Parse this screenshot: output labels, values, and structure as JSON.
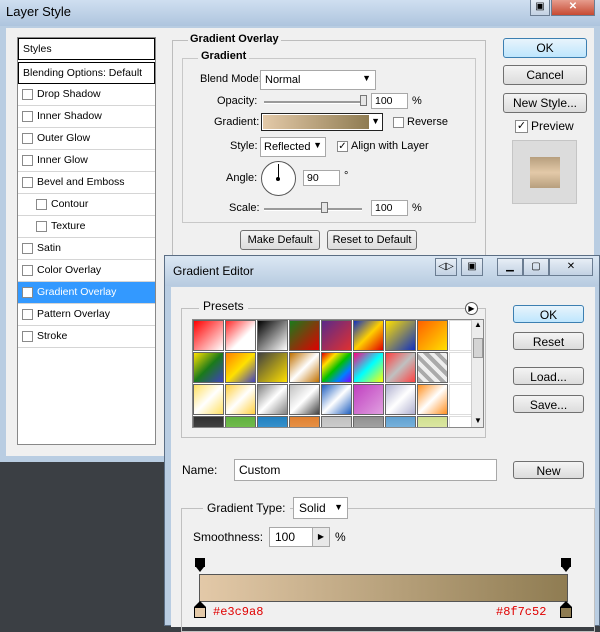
{
  "layer_style": {
    "title": "Layer Style",
    "styles_header": "Styles",
    "blending_options": "Blending Options: Default",
    "effects": [
      {
        "label": "Drop Shadow",
        "checked": false,
        "indent": false,
        "selected": false
      },
      {
        "label": "Inner Shadow",
        "checked": false,
        "indent": false,
        "selected": false
      },
      {
        "label": "Outer Glow",
        "checked": false,
        "indent": false,
        "selected": false
      },
      {
        "label": "Inner Glow",
        "checked": false,
        "indent": false,
        "selected": false
      },
      {
        "label": "Bevel and Emboss",
        "checked": false,
        "indent": false,
        "selected": false
      },
      {
        "label": "Contour",
        "checked": false,
        "indent": true,
        "selected": false
      },
      {
        "label": "Texture",
        "checked": false,
        "indent": true,
        "selected": false
      },
      {
        "label": "Satin",
        "checked": false,
        "indent": false,
        "selected": false
      },
      {
        "label": "Color Overlay",
        "checked": false,
        "indent": false,
        "selected": false
      },
      {
        "label": "Gradient Overlay",
        "checked": true,
        "indent": false,
        "selected": true
      },
      {
        "label": "Pattern Overlay",
        "checked": false,
        "indent": false,
        "selected": false
      },
      {
        "label": "Stroke",
        "checked": false,
        "indent": false,
        "selected": false
      }
    ],
    "group_title": "Gradient Overlay",
    "subgroup_title": "Gradient",
    "blend_mode_label": "Blend Mode:",
    "blend_mode_value": "Normal",
    "opacity_label": "Opacity:",
    "opacity_value": "100",
    "opacity_unit": "%",
    "opacity_level": 1.0,
    "gradient_label": "Gradient:",
    "reverse_label": "Reverse",
    "reverse_checked": false,
    "style_label": "Style:",
    "style_value": "Reflected",
    "align_label": "Align with Layer",
    "align_checked": true,
    "angle_label": "Angle:",
    "angle_value": "90",
    "angle_unit": "°",
    "scale_label": "Scale:",
    "scale_value": "100",
    "scale_unit": "%",
    "make_default": "Make Default",
    "reset_default": "Reset to Default",
    "ok": "OK",
    "cancel": "Cancel",
    "new_style": "New Style...",
    "preview_label": "Preview",
    "preview_checked": true
  },
  "gradient_editor": {
    "title": "Gradient Editor",
    "presets_label": "Presets",
    "ok": "OK",
    "reset": "Reset",
    "load": "Load...",
    "save": "Save...",
    "name_label": "Name:",
    "name_value": "Custom",
    "new_button": "New",
    "gradient_type_label": "Gradient Type:",
    "gradient_type_value": "Solid",
    "smoothness_label": "Smoothness:",
    "smoothness_value": "100",
    "smoothness_unit": "%",
    "stop_left_label": "#e3c9a8",
    "stop_right_label": "#8f7c52"
  },
  "colors": {
    "gradient_start": "#e3c9a8",
    "gradient_end": "#8f7c52",
    "selection": "#3399ff",
    "annotation": "#e00000"
  },
  "icons": [
    "window-close-icon",
    "window-minimize-icon",
    "window-maximize-icon",
    "menu-arrow-icon",
    "dropdown-arrow-icon",
    "checkbox-icon"
  ]
}
